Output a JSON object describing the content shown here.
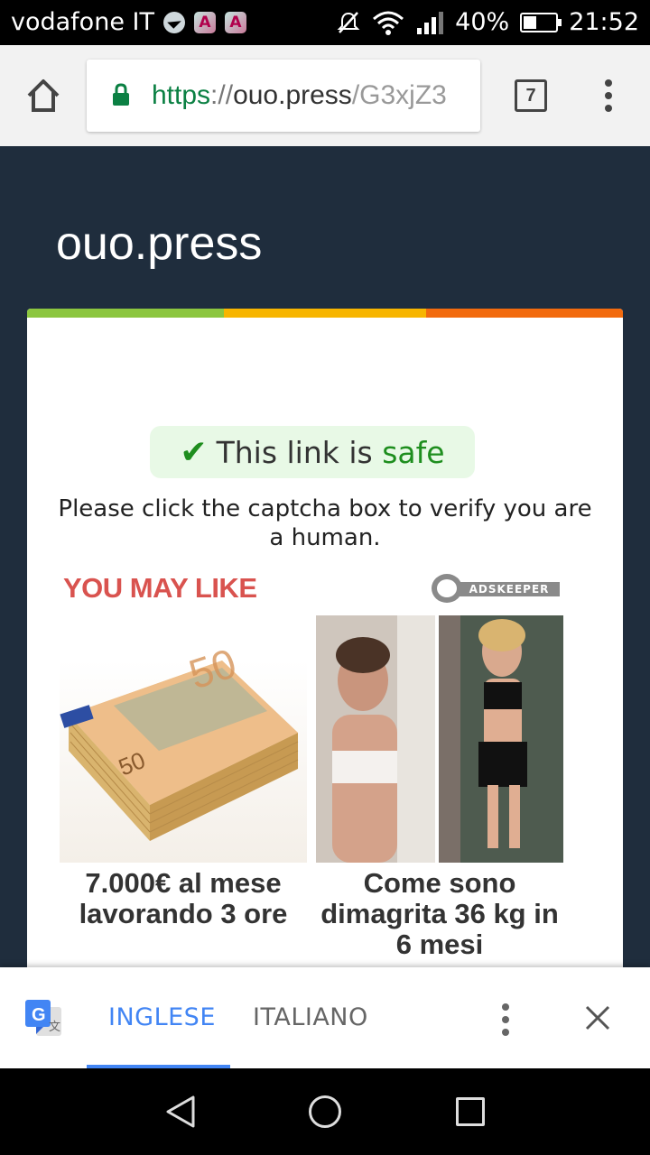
{
  "status_bar": {
    "carrier": "vodafone IT",
    "battery_percent": "40%",
    "battery_level": 0.4,
    "time": "21:52",
    "icons": [
      "telegram-icon",
      "app-a-icon",
      "app-a-icon",
      "mute-icon",
      "wifi-icon",
      "signal-icon",
      "battery-icon"
    ]
  },
  "browser": {
    "url_scheme": "https",
    "url_sep": "://",
    "url_host": "ouo.press",
    "url_path": "/G3xjZ3",
    "tab_count": "7",
    "secure_color": "#0b8043"
  },
  "page": {
    "site_title": "ouo.press",
    "safe_text": "This link is",
    "safe_word": "safe",
    "instruction": "Please click the captcha box to verify you are a human.",
    "you_may_like": "YOU MAY LIKE",
    "ad_network": "ADSKEEPER",
    "ads": [
      {
        "caption": "7.000€ al mese lavorando 3 ore",
        "image": "euro-banknotes-image"
      },
      {
        "caption": "Come sono dimagrita 36 kg in 6 mesi",
        "image": "before-after-photo"
      }
    ],
    "colors": {
      "background": "#1f2d3d",
      "strip_green": "#8cc63f",
      "strip_yellow": "#f7b500",
      "strip_orange": "#f26a0e",
      "safe_green": "#1e8e1e",
      "you_may_like_red": "#d9534f"
    }
  },
  "translate_bar": {
    "lang_active": "INGLESE",
    "lang_inactive": "ITALIANO",
    "accent": "#4285f4"
  }
}
